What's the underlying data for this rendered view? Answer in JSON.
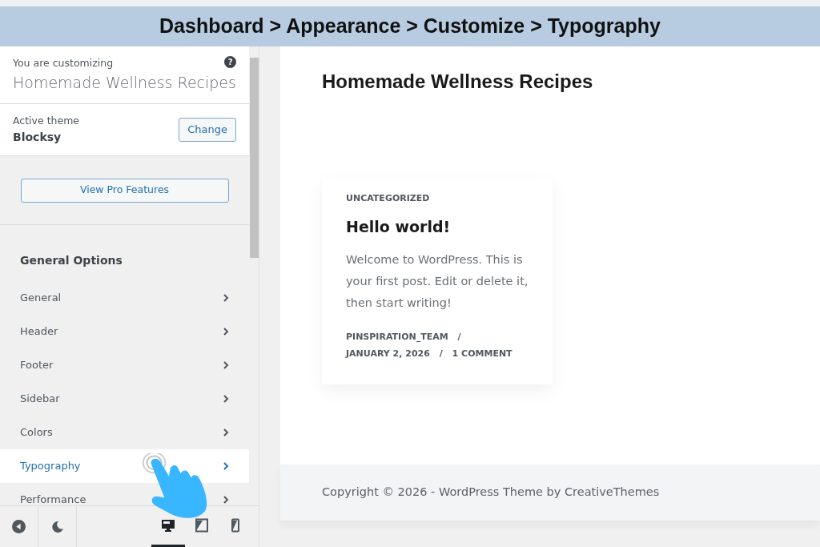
{
  "banner": {
    "title": "Dashboard > Appearance > Customize > Typography"
  },
  "sidebar": {
    "customizing_label": "You are customizing",
    "site_title": "Homemade Wellness Recipes",
    "help_icon": "?",
    "theme_label": "Active theme",
    "theme_name": "Blocksy",
    "change_button": "Change",
    "pro_button": "View Pro Features",
    "section_title": "General Options",
    "items": [
      {
        "label": "General",
        "selected": false
      },
      {
        "label": "Header",
        "selected": false
      },
      {
        "label": "Footer",
        "selected": false
      },
      {
        "label": "Sidebar",
        "selected": false
      },
      {
        "label": "Colors",
        "selected": false
      },
      {
        "label": "Typography",
        "selected": true
      },
      {
        "label": "Performance",
        "selected": false
      }
    ],
    "devices": [
      {
        "kind": "desktop",
        "selected": true
      },
      {
        "kind": "tablet",
        "selected": false
      },
      {
        "kind": "mobile",
        "selected": false
      }
    ]
  },
  "preview": {
    "site_title": "Homemade Wellness Recipes",
    "post": {
      "category": "UNCATEGORIZED",
      "title": "Hello world!",
      "excerpt": "Welcome to WordPress. This is your first post. Edit or delete it, then start writing!",
      "author": "PINSPIRATION_TEAM",
      "separator_1": "/",
      "date": "JANUARY 2, 2026",
      "separator_2": "/",
      "comments": "1 COMMENT"
    },
    "footer": "Copyright © 2026 - WordPress Theme by CreativeThemes"
  }
}
